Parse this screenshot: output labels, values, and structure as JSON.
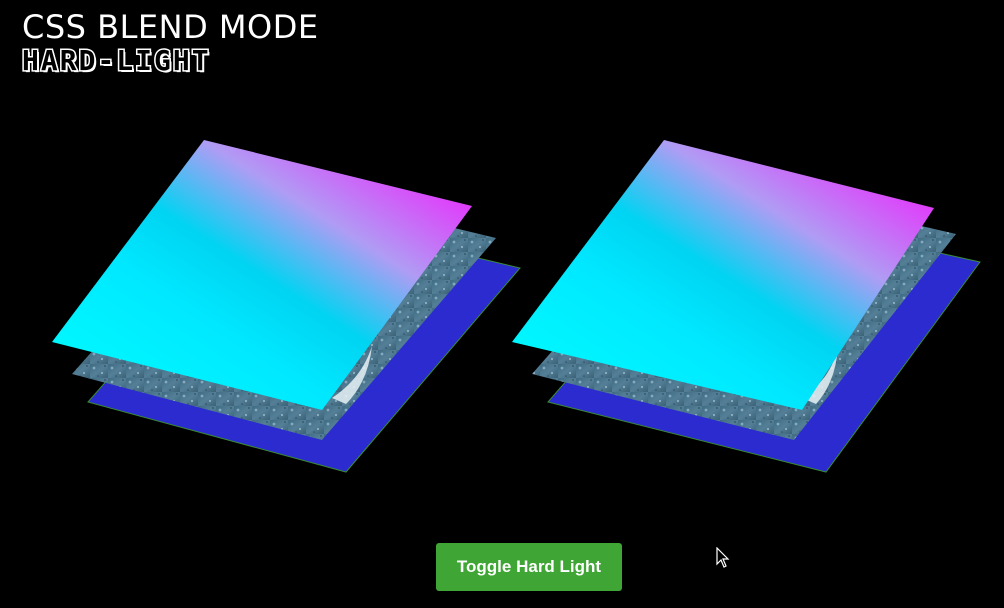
{
  "header": {
    "title": "CSS BLEND MODE",
    "mode_name": "HARD-LIGHT"
  },
  "stacks": [
    {
      "label": "",
      "layers": [
        {
          "kind": "solid",
          "color": "#2b2bd0"
        },
        {
          "kind": "photo",
          "color": "#4f7a92"
        },
        {
          "kind": "gradient",
          "colors": [
            "#00ffff",
            "#00d8f4",
            "#ff00ff"
          ]
        }
      ]
    },
    {
      "label": "",
      "layers": [
        {
          "kind": "solid",
          "color": "#2b2bd0"
        },
        {
          "kind": "photo",
          "color": "#4f7a92"
        },
        {
          "kind": "gradient",
          "colors": [
            "#00ffff",
            "#00d8f4",
            "#ff00ff"
          ]
        }
      ]
    }
  ],
  "toggle": {
    "label": "Toggle Hard Light",
    "color": "#3fa535"
  }
}
